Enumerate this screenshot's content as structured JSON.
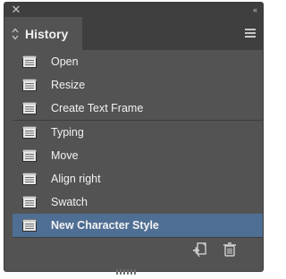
{
  "panel": {
    "title": "History",
    "close_icon": "close-icon",
    "collapse_icon": "double-chevron-left-icon",
    "menu_icon": "hamburger-menu-icon"
  },
  "history": {
    "items": [
      {
        "label": "Open",
        "selected": false
      },
      {
        "label": "Resize",
        "selected": false
      },
      {
        "label": "Create Text Frame",
        "selected": false
      },
      {
        "label": "Typing",
        "selected": false
      },
      {
        "label": "Move",
        "selected": false
      },
      {
        "label": "Align right",
        "selected": false
      },
      {
        "label": "Swatch",
        "selected": false
      },
      {
        "label": "New Character Style",
        "selected": true
      }
    ]
  },
  "footer": {
    "new_document_icon": "new-document-from-state-icon",
    "delete_icon": "trash-icon"
  },
  "colors": {
    "panel_bg": "#535353",
    "selected_row": "#4f6e93",
    "text": "#f2f2f2"
  }
}
